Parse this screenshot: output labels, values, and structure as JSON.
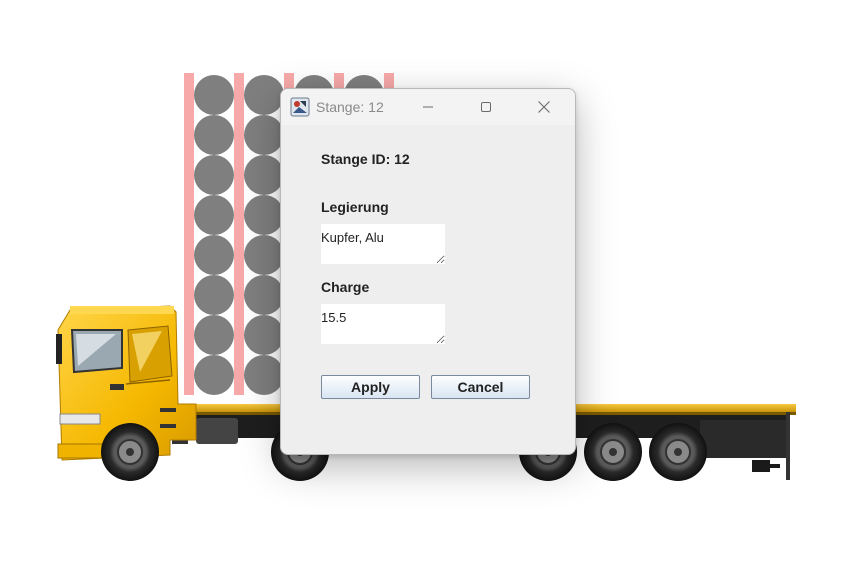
{
  "dialog": {
    "title": "Stange: 12",
    "id_label": "Stange ID: 12",
    "legierung_label": "Legierung",
    "legierung_value": "Kupfer, Alu",
    "charge_label": "Charge",
    "charge_value": "15.5",
    "apply_label": "Apply",
    "cancel_label": "Cancel"
  },
  "colors": {
    "rack": "#f7a9a9",
    "rod": "#7f7f7f",
    "truck_cab": "#f5b800",
    "dialog_bg": "#eeeeee"
  },
  "icons": [
    "app-icon",
    "minimize-icon",
    "maximize-icon",
    "close-icon"
  ]
}
